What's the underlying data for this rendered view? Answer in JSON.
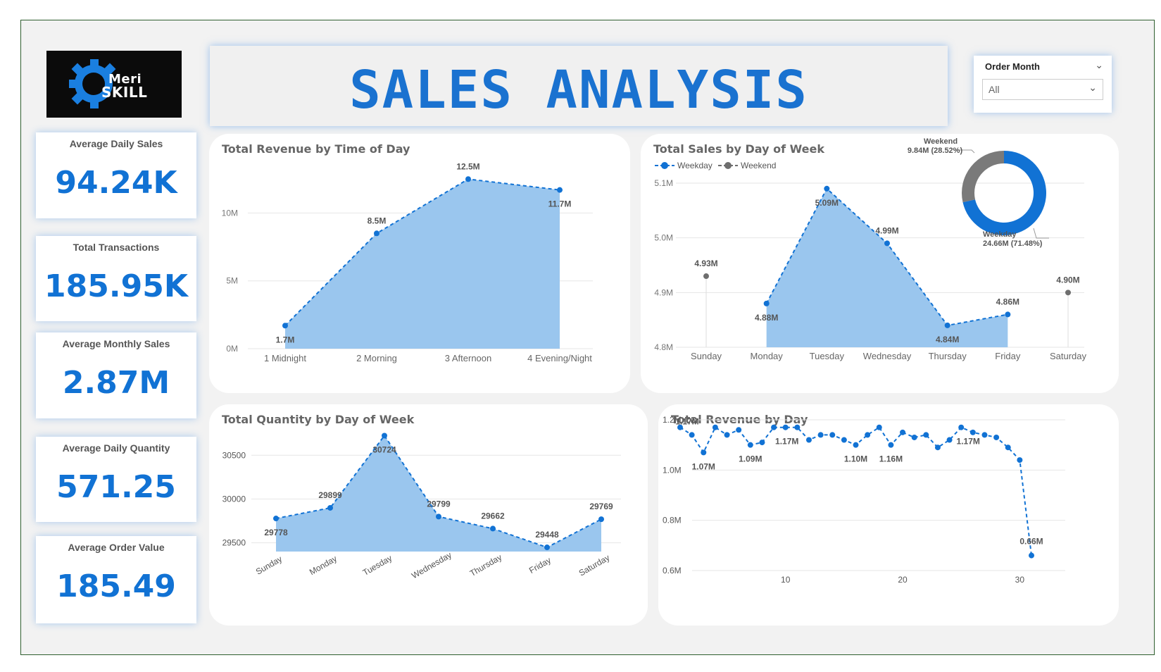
{
  "logo": {
    "line1": "Meri",
    "line2": "SKILL"
  },
  "banner": {
    "title": "SALES ANALYSIS"
  },
  "slicer": {
    "label": "Order Month",
    "value": "All"
  },
  "kpis": [
    {
      "label": "Average Daily Sales",
      "value": "94.24K"
    },
    {
      "label": "Total Transactions",
      "value": "185.95K"
    },
    {
      "label": "Average Monthly Sales",
      "value": "2.87M"
    },
    {
      "label": "Average Daily Quantity",
      "value": "571.25"
    },
    {
      "label": "Average Order Value",
      "value": "185.49"
    }
  ],
  "colors": {
    "accent": "#1172d4",
    "area": "#9ac6ee",
    "weekend": "#6e6e6e",
    "title_blue": "#1a72d0"
  },
  "chart_data": [
    {
      "id": "time_of_day",
      "type": "area",
      "title": "Total Revenue by Time of Day",
      "categories": [
        "1 Midnight",
        "2 Morning",
        "3 Afternoon",
        "4 Evening/Night"
      ],
      "values": [
        1.7,
        8.5,
        12.5,
        11.7
      ],
      "labels": [
        "1.7M",
        "8.5M",
        "12.5M",
        "11.7M"
      ],
      "yticks": [
        "0M",
        "5M",
        "10M"
      ],
      "ylim": [
        0,
        13.5
      ]
    },
    {
      "id": "sales_by_dow",
      "type": "area",
      "title": "Total Sales by Day of Week",
      "categories": [
        "Sunday",
        "Monday",
        "Tuesday",
        "Wednesday",
        "Thursday",
        "Friday",
        "Saturday"
      ],
      "series": [
        {
          "name": "Weekday",
          "values": [
            null,
            4.88,
            5.09,
            4.99,
            4.84,
            4.86,
            null
          ],
          "labels": [
            "",
            "4.88M",
            "5.09M",
            "4.99M",
            "4.84M",
            "4.86M",
            ""
          ]
        },
        {
          "name": "Weekend",
          "values": [
            4.93,
            null,
            null,
            null,
            null,
            null,
            4.9
          ],
          "labels": [
            "4.93M",
            "",
            "",
            "",
            "",
            "",
            "4.90M"
          ]
        }
      ],
      "yticks": [
        "4.8M",
        "4.9M",
        "5.0M",
        "5.1M"
      ],
      "ylim": [
        4.8,
        5.1
      ],
      "donut": {
        "slices": [
          {
            "name": "Weekday",
            "value": 24.66,
            "label": "24.66M (71.48%)"
          },
          {
            "name": "Weekend",
            "value": 9.84,
            "label": "9.84M (28.52%)"
          }
        ]
      }
    },
    {
      "id": "qty_by_dow",
      "type": "area",
      "title": "Total Quantity by Day of Week",
      "categories": [
        "Sunday",
        "Monday",
        "Tuesday",
        "Wednesday",
        "Thursday",
        "Friday",
        "Saturday"
      ],
      "values": [
        29778,
        29899,
        30724,
        29799,
        29662,
        29448,
        29769
      ],
      "labels": [
        "29778",
        "29899",
        "30724",
        "29799",
        "29662",
        "29448",
        "29769"
      ],
      "yticks": [
        "29500",
        "30000",
        "30500"
      ],
      "ylim": [
        29400,
        30800
      ]
    },
    {
      "id": "revenue_by_day",
      "type": "line",
      "title": "Total Revenue by Day",
      "x": [
        1,
        2,
        3,
        4,
        5,
        6,
        7,
        8,
        9,
        10,
        11,
        12,
        13,
        14,
        15,
        16,
        17,
        18,
        19,
        20,
        21,
        22,
        23,
        24,
        25,
        26,
        27,
        28,
        29,
        30,
        31
      ],
      "values": [
        1.17,
        1.14,
        1.07,
        1.17,
        1.14,
        1.16,
        1.1,
        1.11,
        1.17,
        1.17,
        1.17,
        1.12,
        1.14,
        1.14,
        1.12,
        1.1,
        1.14,
        1.17,
        1.1,
        1.15,
        1.13,
        1.14,
        1.09,
        1.12,
        1.17,
        1.15,
        1.14,
        1.13,
        1.09,
        1.04,
        0.66
      ],
      "labels": [
        {
          "x": 1,
          "text": "1.17M"
        },
        {
          "x": 3,
          "text": "1.07M"
        },
        {
          "x": 7,
          "text": "1.09M"
        },
        {
          "x": 10,
          "text": "1.17M"
        },
        {
          "x": 16,
          "text": "1.10M"
        },
        {
          "x": 19,
          "text": "1.16M"
        },
        {
          "x": 25,
          "text": "1.17M"
        },
        {
          "x": 31,
          "text": "0.66M"
        }
      ],
      "yticks": [
        "0.6M",
        "0.8M",
        "1.0M",
        "1.2M"
      ],
      "xticks": [
        "10",
        "20",
        "30"
      ],
      "ylim": [
        0.6,
        1.2
      ]
    }
  ]
}
